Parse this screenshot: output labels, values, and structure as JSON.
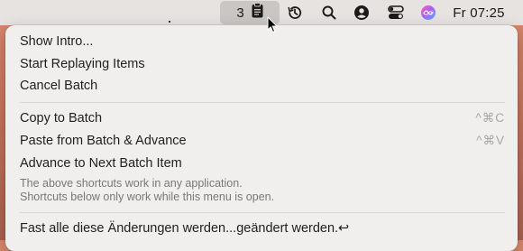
{
  "menubar": {
    "batch_count": "3",
    "clock": "Fr 07:25",
    "icons": [
      "clipboard-icon",
      "history-icon",
      "search-icon",
      "user-account-icon",
      "control-center-icon",
      "siri-icon"
    ]
  },
  "menu": {
    "show_intro": "Show Intro...",
    "start_replaying": "Start Replaying Items",
    "cancel_batch": "Cancel Batch",
    "copy_to_batch": {
      "label": "Copy to Batch",
      "shortcut": "^⌘C"
    },
    "paste_from_batch": {
      "label": "Paste from Batch & Advance",
      "shortcut": "^⌘V"
    },
    "advance_next": "Advance to Next Batch Item",
    "note_line1": "The above shortcuts work in any application.",
    "note_line2": "Shortcuts below only work while this menu is open.",
    "batch_item": "Fast alle diese Änderungen werden...geändert werden.↩"
  },
  "colors": {
    "menu_bg": "#f0efee",
    "menubar_bg": "#e6e3e1",
    "shortcut_text": "#a8a6a4",
    "note_text": "#7a7876"
  }
}
